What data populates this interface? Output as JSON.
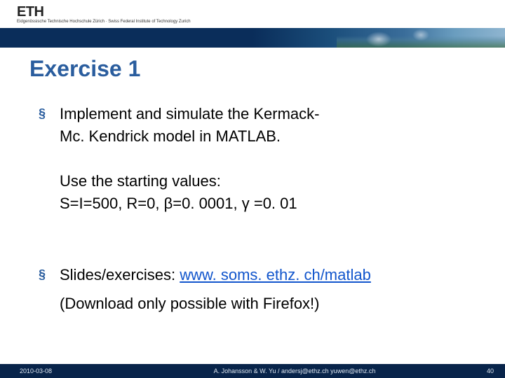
{
  "header": {
    "logo": "ETH",
    "subline": "Eidgenössische Technische Hochschule Zürich · Swiss Federal Institute of Technology Zurich"
  },
  "title": "Exercise 1",
  "bullets": {
    "b1_line1": "Implement and simulate the Kermack-",
    "b1_line2": "Mc. Kendrick model in MATLAB.",
    "use_line1": "Use the starting values:",
    "use_line2": "S=I=500, R=0, β=0. 0001, γ =0. 01",
    "b2_prefix": "Slides/exercises: ",
    "b2_link": "www. soms. ethz. ch/matlab",
    "note": "(Download only possible with Firefox!)"
  },
  "footer": {
    "date": "2010-03-08",
    "author": "A. Johansson & W. Yu / andersj@ethz.ch yuwen@ethz.ch",
    "page": "40"
  }
}
